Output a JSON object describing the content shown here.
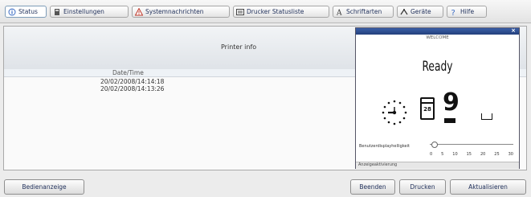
{
  "tabs": [
    {
      "label": "Status",
      "icon": "info-icon",
      "active": true
    },
    {
      "label": "Einstellungen",
      "icon": "settings-icon",
      "active": false
    },
    {
      "label": "Systemnachrichten",
      "icon": "warning-icon",
      "active": false
    },
    {
      "label": "Drucker Statusliste",
      "icon": "list-icon",
      "active": false
    },
    {
      "label": "Schriftarten",
      "icon": "font-icon",
      "active": false
    },
    {
      "label": "Geräte",
      "icon": "devices-icon",
      "active": false
    },
    {
      "label": "Hilfe",
      "icon": "help-icon",
      "active": false
    }
  ],
  "panel": {
    "title": "Printer info",
    "column_header": "Date/Time",
    "rows": [
      "20/02/2008/14:14:18",
      "20/02/2008/14:13:26"
    ]
  },
  "display": {
    "subtitle": "WELCOME",
    "status": "Ready",
    "date_number": "28",
    "big_digit": "9",
    "slider_label": "Benutzerdisplayhelligkeit",
    "slider_ticks": [
      "0",
      "5",
      "10",
      "15",
      "20",
      "25",
      "30"
    ],
    "slider_value": 0,
    "status_bar": "Anzeigeaktivierung"
  },
  "buttons": {
    "left": "Bedienanzeige",
    "right": [
      "Beenden",
      "Drucken",
      "Aktualisieren"
    ]
  },
  "colors": {
    "title_bar": "#2b4a8f",
    "accent_text": "#1f2f5a"
  }
}
